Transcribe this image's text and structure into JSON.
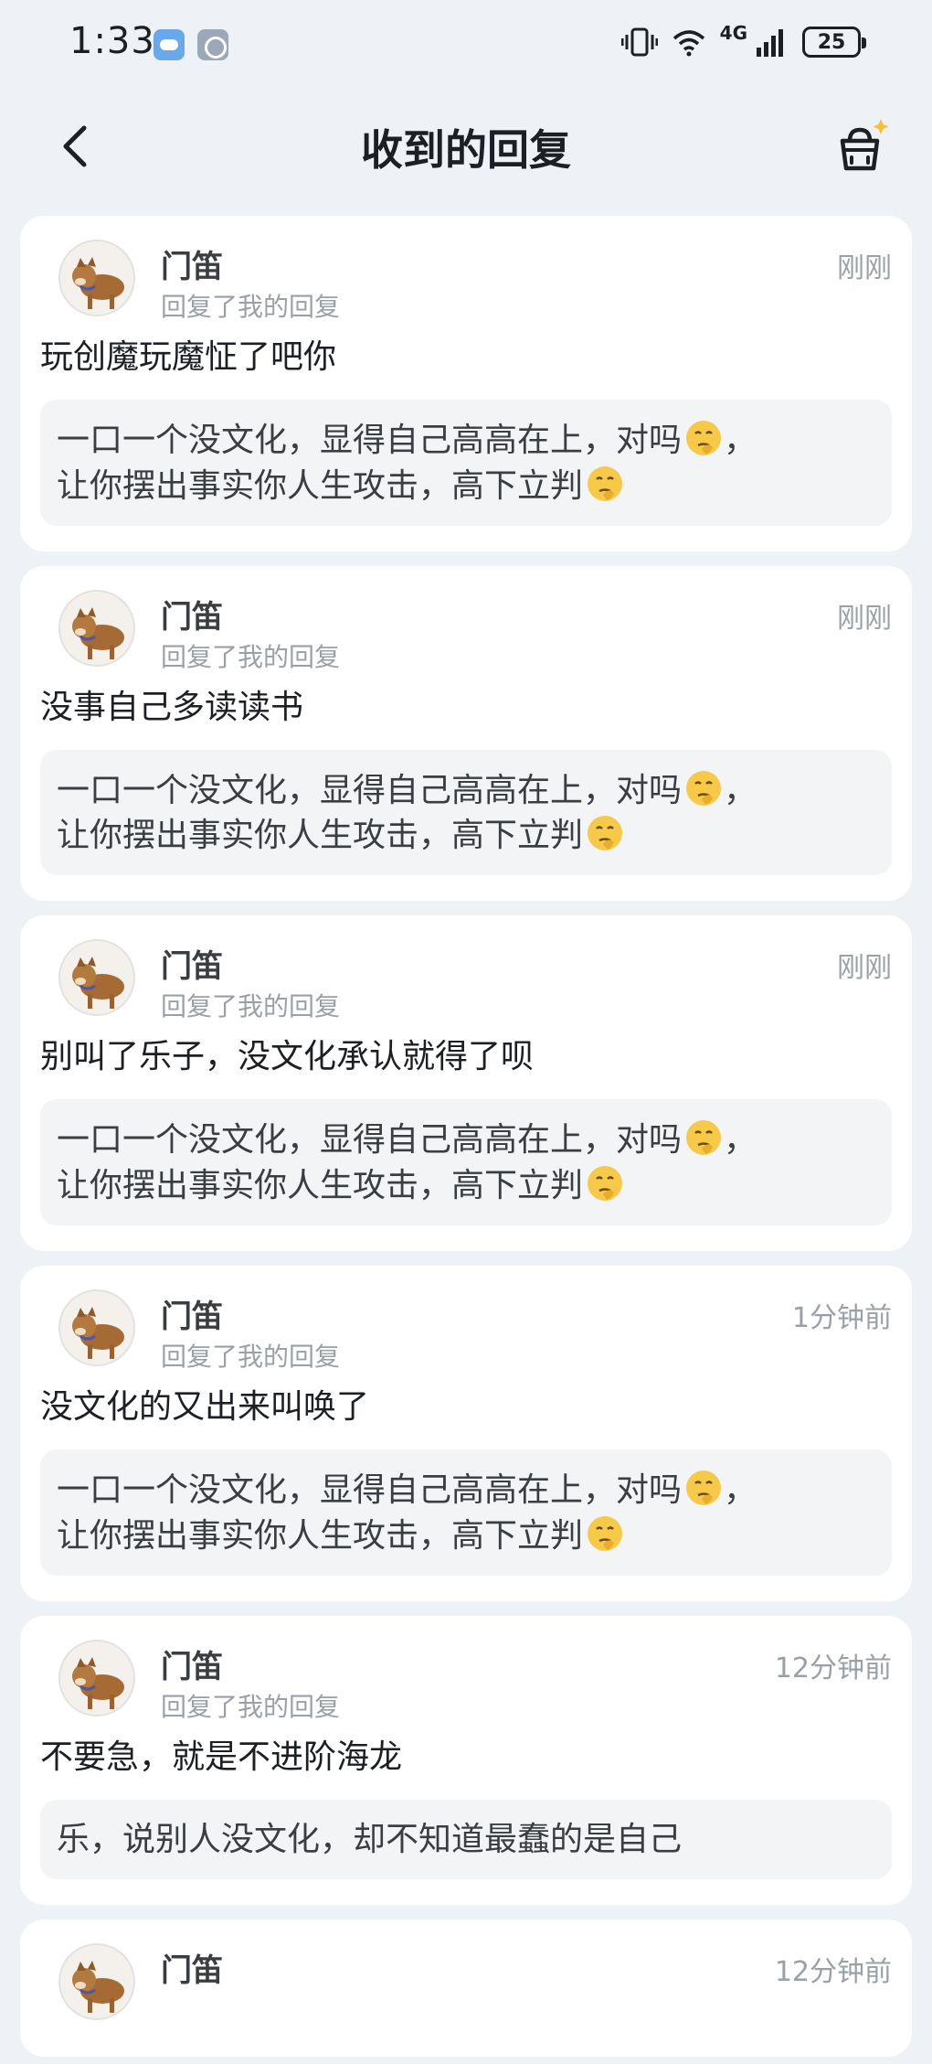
{
  "status_bar": {
    "time": "1:33",
    "network": "4G",
    "battery": "25"
  },
  "header": {
    "title": "收到的回复"
  },
  "replies": [
    {
      "name": "门笛",
      "meta": "回复了我的回复",
      "time": "刚刚",
      "text": "玩创魔玩魔怔了吧你",
      "quote_line1": "一口一个没文化，显得自己高高在上，对吗",
      "quote_line1_tail": "，",
      "quote_line2": "让你摆出事实你人生攻击，高下立判"
    },
    {
      "name": "门笛",
      "meta": "回复了我的回复",
      "time": "刚刚",
      "text": "没事自己多读读书",
      "quote_line1": "一口一个没文化，显得自己高高在上，对吗",
      "quote_line1_tail": "，",
      "quote_line2": "让你摆出事实你人生攻击，高下立判"
    },
    {
      "name": "门笛",
      "meta": "回复了我的回复",
      "time": "刚刚",
      "text": "别叫了乐子，没文化承认就得了呗",
      "quote_line1": "一口一个没文化，显得自己高高在上，对吗",
      "quote_line1_tail": "，",
      "quote_line2": "让你摆出事实你人生攻击，高下立判"
    },
    {
      "name": "门笛",
      "meta": "回复了我的回复",
      "time": "1分钟前",
      "text": "没文化的又出来叫唤了",
      "quote_line1": "一口一个没文化，显得自己高高在上，对吗",
      "quote_line1_tail": "，",
      "quote_line2": "让你摆出事实你人生攻击，高下立判"
    },
    {
      "name": "门笛",
      "meta": "回复了我的回复",
      "time": "12分钟前",
      "text": "不要急，就是不进阶海龙",
      "quote_single": "乐，说别人没文化，却不知道最蠢的是自己"
    },
    {
      "name": "门笛",
      "time": "12分钟前"
    }
  ]
}
